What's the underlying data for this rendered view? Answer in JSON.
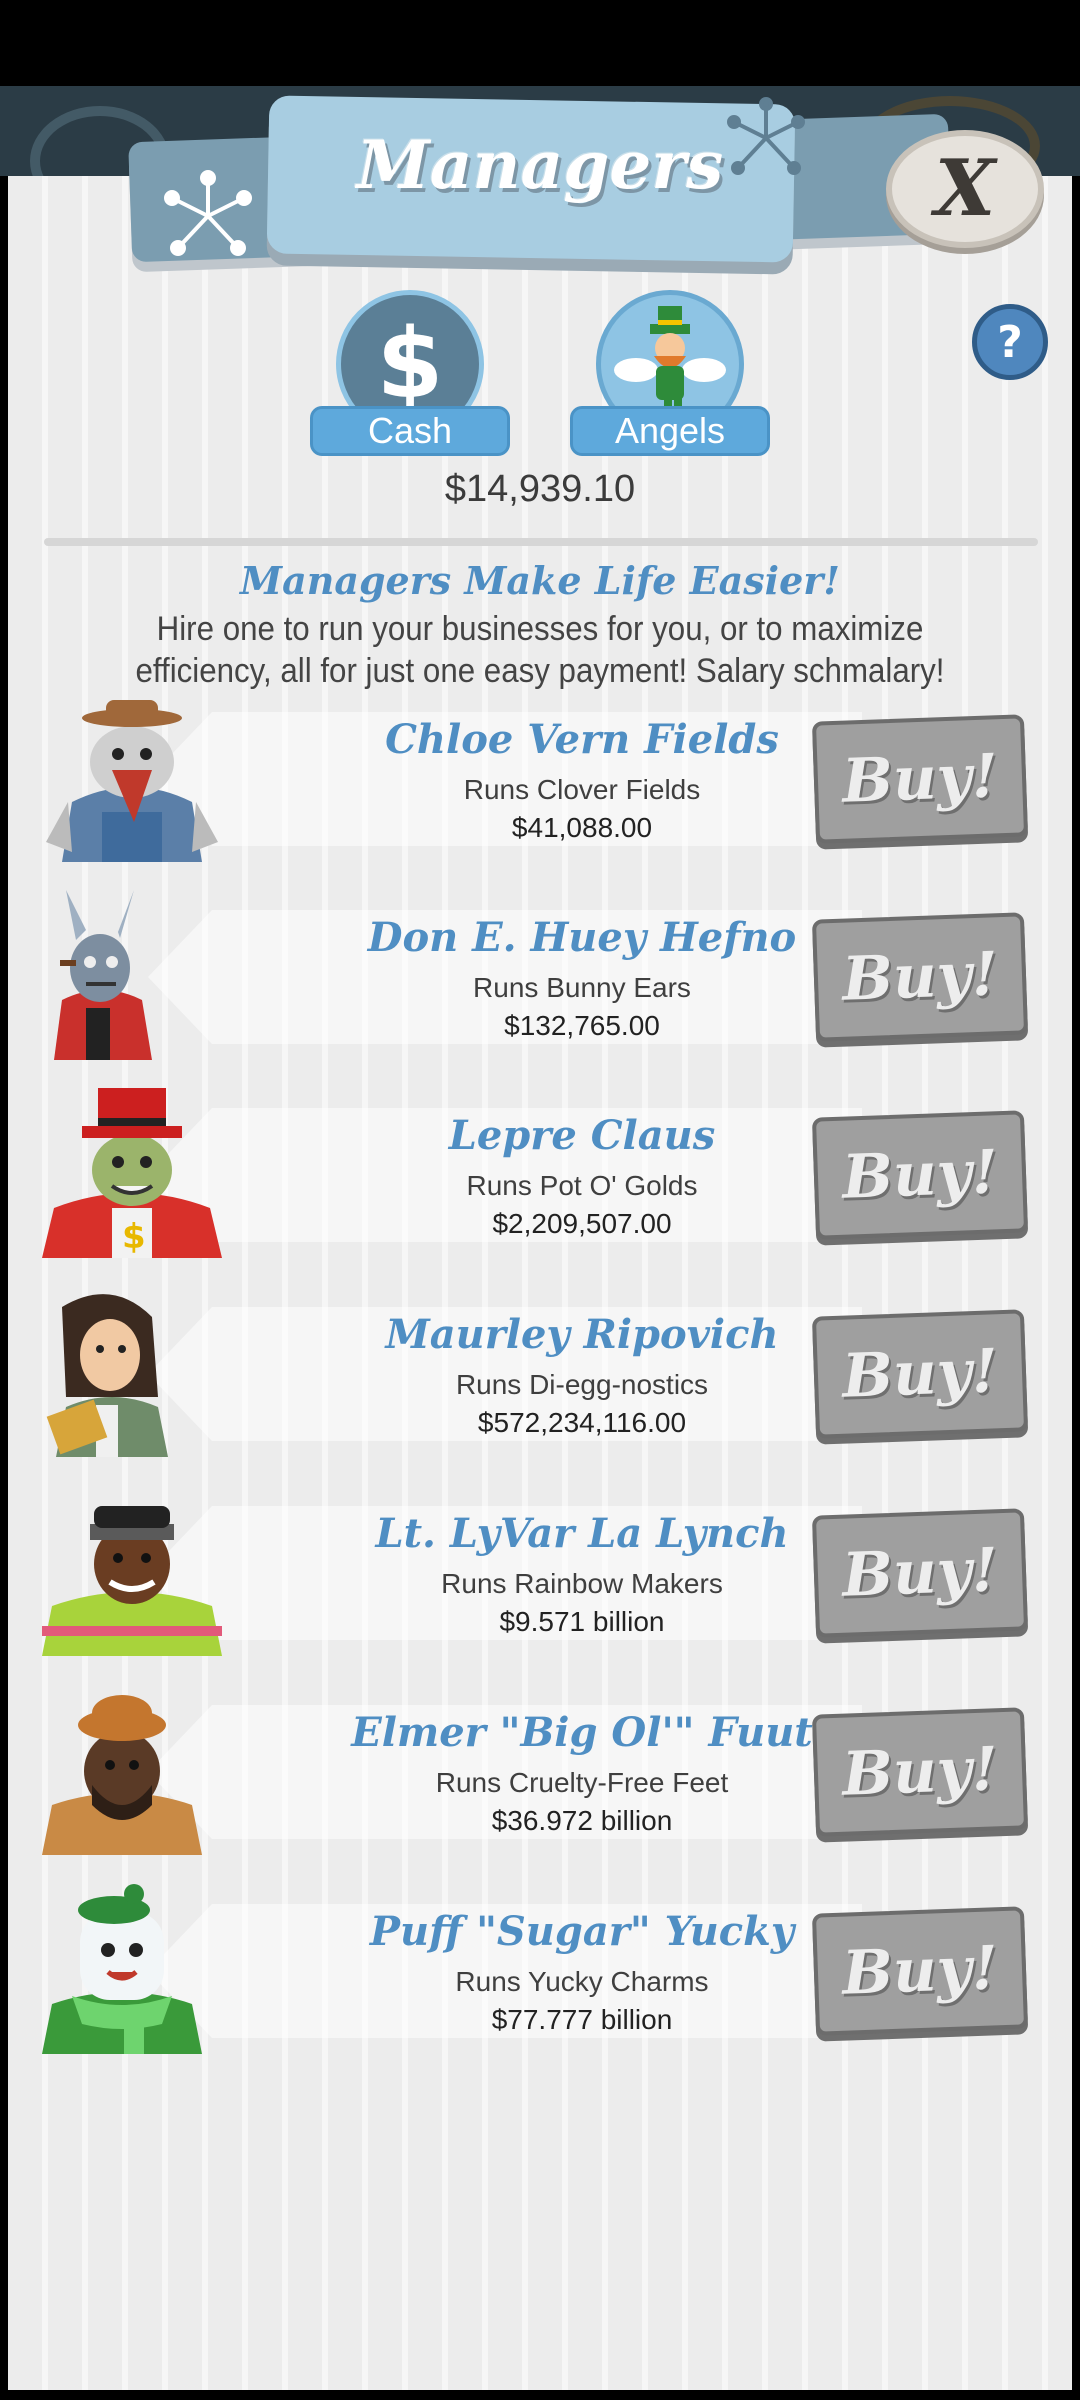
{
  "header": {
    "title": "Managers"
  },
  "currency": {
    "cash_label": "Cash",
    "cash_symbol": "$",
    "angels_label": "Angels",
    "cash_amount": "$14,939.10"
  },
  "intro": {
    "headline": "Managers Make Life Easier!",
    "text": "Hire one to run your businesses for you, or to maximize efficiency, all for just one easy payment! Salary schmalary!"
  },
  "buttons": {
    "close": "X",
    "help": "?",
    "buy": "Buy!"
  },
  "managers": [
    {
      "name": "Chloe Vern Fields",
      "runs": "Runs Clover Fields",
      "price": "$41,088.00"
    },
    {
      "name": "Don E. Huey Hefno",
      "runs": "Runs Bunny Ears",
      "price": "$132,765.00"
    },
    {
      "name": "Lepre Claus",
      "runs": "Runs Pot O' Golds",
      "price": "$2,209,507.00"
    },
    {
      "name": "Maurley Ripovich",
      "runs": "Runs Di-egg-nostics",
      "price": "$572,234,116.00"
    },
    {
      "name": "Lt. LyVar La Lynch",
      "runs": "Runs Rainbow Makers",
      "price": "$9.571 billion"
    },
    {
      "name": "Elmer \"Big Ol'\" Fuut",
      "runs": "Runs Cruelty-Free Feet",
      "price": "$36.972 billion"
    },
    {
      "name": "Puff \"Sugar\" Yucky",
      "runs": "Runs Yucky Charms",
      "price": "$77.777 billion"
    }
  ],
  "colors": {
    "accent_blue": "#4f8ec3",
    "tab_blue": "#5ea9dc",
    "buy_gray": "#9f9f9f",
    "panel_bg": "#ececec"
  }
}
